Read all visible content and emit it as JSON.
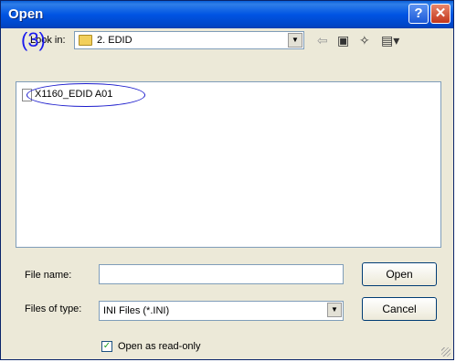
{
  "window": {
    "title": "Open"
  },
  "title_buttons": {
    "help": "?",
    "close": "✕"
  },
  "annotation": {
    "label": "(3)"
  },
  "toolbar": {
    "lookin_label_prefix": "L",
    "lookin_label_mid": "ook",
    "lookin_label_suffix": " in:",
    "lookin_value": "2. EDID"
  },
  "files": [
    {
      "name": "X1160_EDID A01"
    }
  ],
  "form": {
    "file_name_label": "File name:",
    "file_name_value": "",
    "files_of_type_label": "Files of type:",
    "files_of_type_value": "INI Files (*.INI)",
    "open_label": "Open",
    "cancel_label": "Cancel",
    "readonly_label": "Open as read-only",
    "readonly_checked": true
  }
}
